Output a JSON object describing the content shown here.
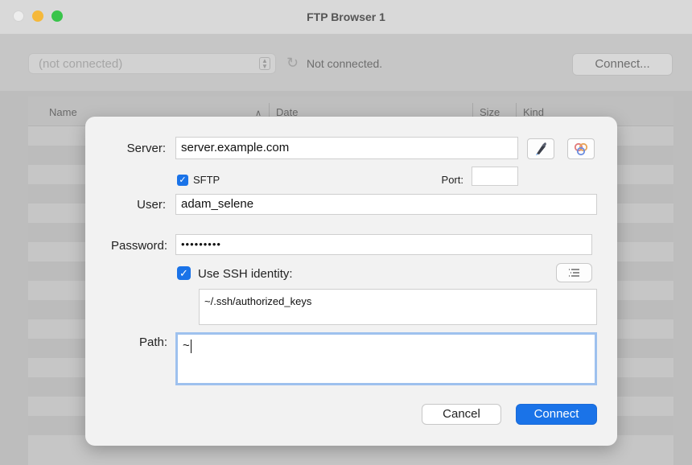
{
  "window": {
    "title": "FTP Browser 1",
    "traffic_colors": {
      "close": "#ededed",
      "minimize": "#f5b83a",
      "zoom": "#39c44a"
    }
  },
  "toolbar": {
    "connection_select_value": "(not connected)",
    "status_text": "Not connected.",
    "connect_label": "Connect..."
  },
  "table": {
    "columns": [
      "Name",
      "Date",
      "Size",
      "Kind"
    ],
    "sort_indicator": "∧"
  },
  "dialog": {
    "server_label": "Server:",
    "server_value": "server.example.com",
    "sftp_label": "SFTP",
    "sftp_checked": true,
    "port_label": "Port:",
    "port_value": "",
    "user_label": "User:",
    "user_value": "adam_selene",
    "password_label": "Password:",
    "password_value": "•••••••••",
    "ssh_identity_label": "Use SSH identity:",
    "ssh_identity_checked": true,
    "ssh_identity_path": "~/.ssh/authorized_keys",
    "path_label": "Path:",
    "path_value": "~",
    "cancel_label": "Cancel",
    "connect_label": "Connect"
  },
  "colors": {
    "accent": "#1a73e8",
    "focus_ring": "#9ec1ee"
  }
}
